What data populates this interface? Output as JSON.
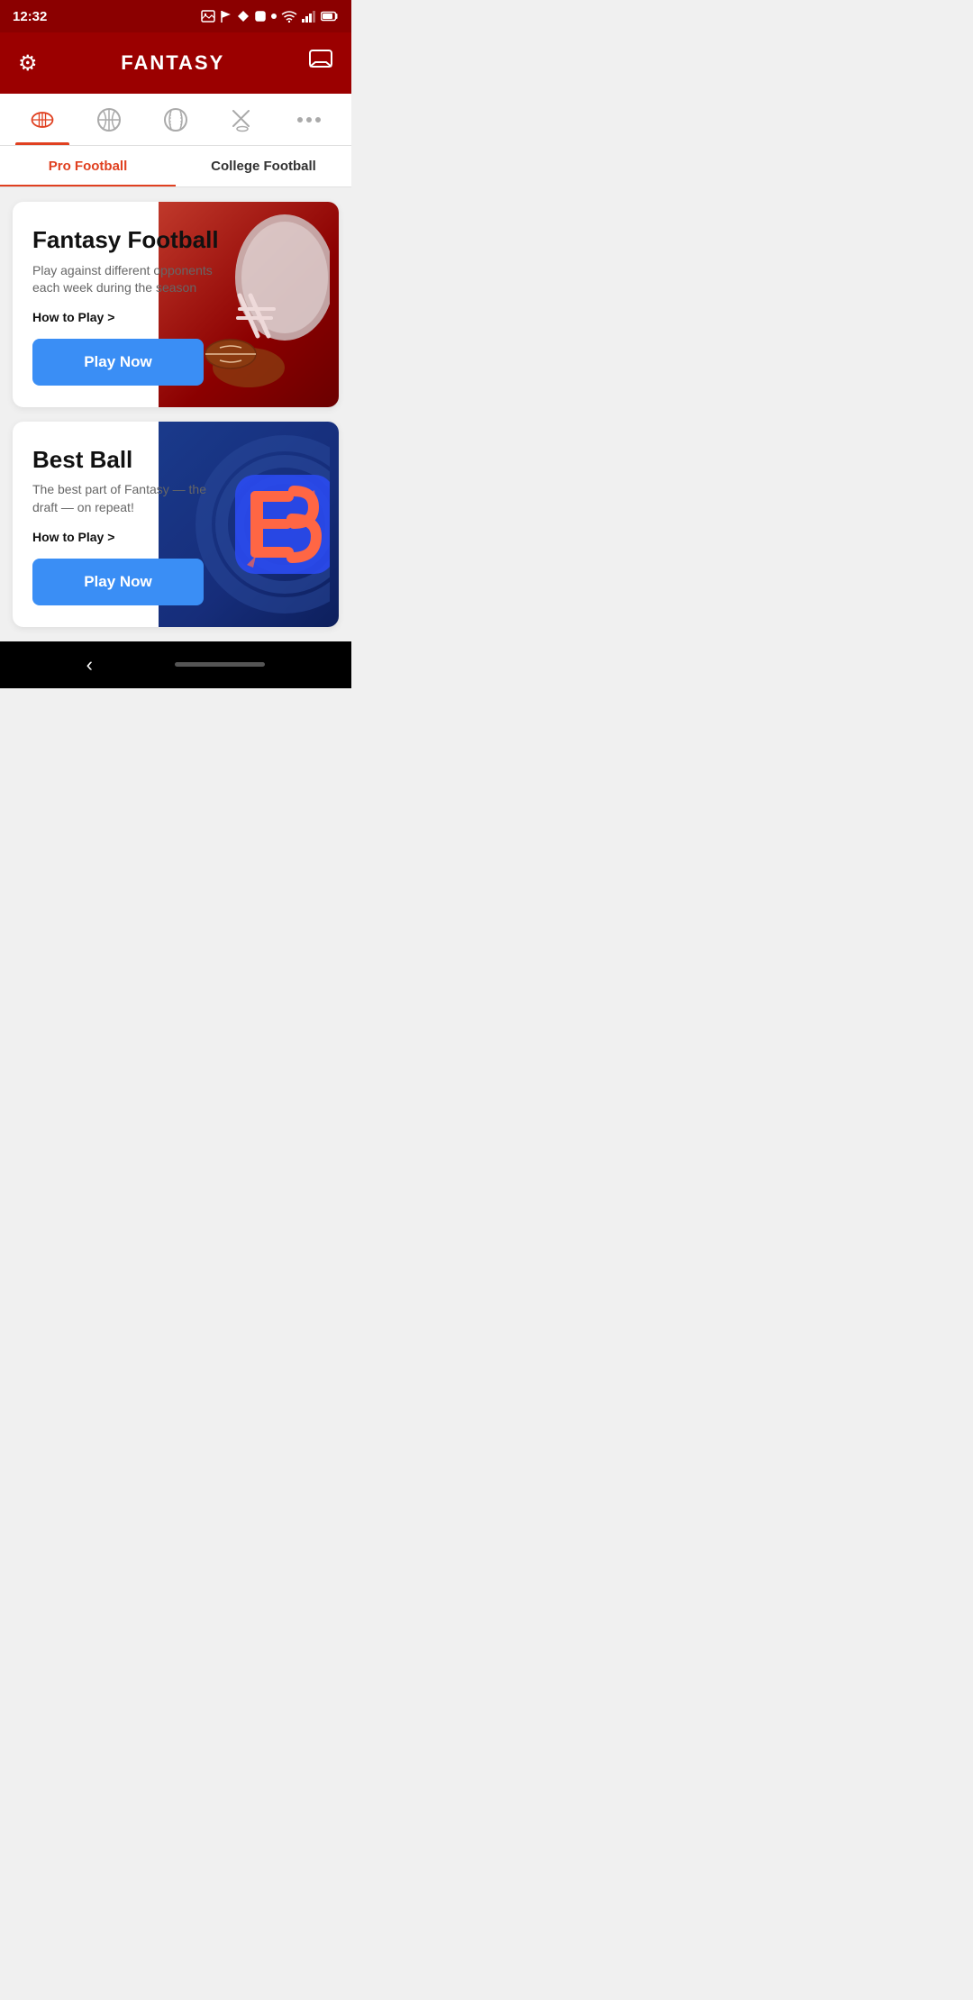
{
  "statusBar": {
    "time": "12:32",
    "icons": [
      "image",
      "navigation",
      "diamond",
      "square",
      "dot"
    ]
  },
  "header": {
    "title": "FANTASY",
    "settingsIcon": "⚙",
    "chatIcon": "💬"
  },
  "sportTabs": [
    {
      "name": "football",
      "active": true
    },
    {
      "name": "basketball",
      "active": false
    },
    {
      "name": "baseball",
      "active": false
    },
    {
      "name": "hockey",
      "active": false
    },
    {
      "name": "more",
      "active": false
    }
  ],
  "subTabs": [
    {
      "label": "Pro Football",
      "active": true
    },
    {
      "label": "College Football",
      "active": false
    }
  ],
  "cards": [
    {
      "title": "Fantasy Football",
      "description": "Play against different opponents each week during the season",
      "howToPlay": "How to Play >",
      "playNow": "Play Now",
      "imageType": "football"
    },
    {
      "title": "Best Ball",
      "description": "The best part of Fantasy — the draft — on repeat!",
      "howToPlay": "How to Play >",
      "playNow": "Play Now",
      "imageType": "bestball"
    }
  ],
  "bottomNav": {
    "backLabel": "‹",
    "homeIndicator": ""
  }
}
